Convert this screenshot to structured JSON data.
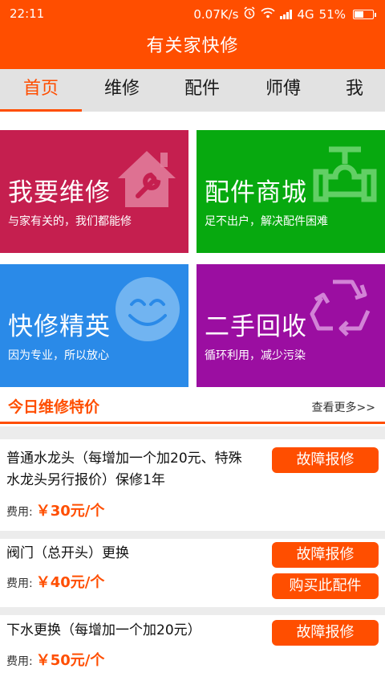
{
  "status_bar": {
    "time": "22:11",
    "speed": "0.07K/s",
    "network": "4G",
    "battery": "51%",
    "battery_level": 0.51
  },
  "app": {
    "title": "有关家快修"
  },
  "tabs": [
    {
      "label": "首页",
      "active": true
    },
    {
      "label": "维修",
      "active": false
    },
    {
      "label": "配件",
      "active": false
    },
    {
      "label": "师傅",
      "active": false
    },
    {
      "label": "我",
      "active": false
    }
  ],
  "tiles": [
    {
      "title": "我要维修",
      "subtitle": "与家有关的，我们都能修",
      "color": "#c51f4f",
      "icon": "house-wrench-icon"
    },
    {
      "title": "配件商城",
      "subtitle": "足不出户，解决配件困难",
      "color": "#07a90f",
      "icon": "valve-icon"
    },
    {
      "title": "快修精英",
      "subtitle": "因为专业，所以放心",
      "color": "#2a8ae8",
      "icon": "smiley-icon"
    },
    {
      "title": "二手回收",
      "subtitle": "循环利用，减少污染",
      "color": "#9b0ea1",
      "icon": "recycle-icon"
    }
  ],
  "specials": {
    "title": "今日维修特价",
    "more": "查看更多>>",
    "fee_label": "费用:",
    "items": [
      {
        "name_line1": "普通水龙头（每增加一个加20元、特殊",
        "name_line2": "水龙头另行报价）保修1年",
        "price": "￥30元/个",
        "buttons": [
          "故障报修"
        ]
      },
      {
        "name_line1": "阀门（总开头）更换",
        "name_line2": "",
        "price": "￥40元/个",
        "buttons": [
          "故障报修",
          "购买此配件"
        ]
      },
      {
        "name_line1": "下水更换（每增加一个加20元）",
        "name_line2": "",
        "price": "￥50元/个",
        "buttons": [
          "故障报修"
        ]
      }
    ]
  },
  "accent": "#ff4e00"
}
